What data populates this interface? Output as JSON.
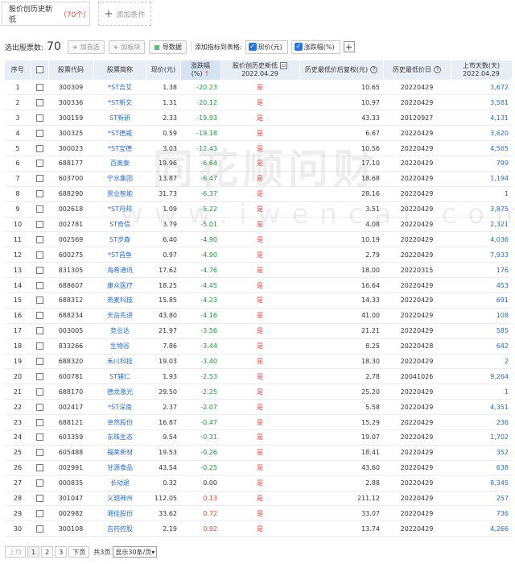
{
  "condition": {
    "label": "股价创历史新低",
    "count": "（70个）",
    "add_label": "添加条件"
  },
  "toolbar": {
    "selected_label": "选出股票数:",
    "selected_count": "70",
    "btn_add_watch": "加自选",
    "btn_add_block": "加板块",
    "btn_export": "导数据",
    "add_indicator_label": "添加指标到表格:",
    "indicators": [
      "现价(元)",
      "涨跌幅(%)"
    ]
  },
  "columns": [
    "序号",
    "股票代码",
    "股票简称",
    "现价(元)",
    "涨跌幅(%)",
    "股价创历史新低",
    "2022.04.29",
    "历史最低价后复权(元)",
    "历史最低价日",
    "上市天数(天)"
  ],
  "rows": [
    [
      "1",
      "300309",
      "*ST吉艾",
      "1.38",
      "-20.23",
      "是",
      "10.65",
      "20220429",
      "3,672"
    ],
    [
      "2",
      "300336",
      "*ST新文",
      "1.31",
      "-20.12",
      "是",
      "10.97",
      "20220429",
      "3,581"
    ],
    [
      "3",
      "300159",
      "ST新研",
      "2.33",
      "-19.93",
      "是",
      "43.33",
      "20120927",
      "4,131"
    ],
    [
      "4",
      "300325",
      "*ST德威",
      "0.59",
      "-19.18",
      "是",
      "6.67",
      "20220429",
      "3,620"
    ],
    [
      "5",
      "300023",
      "*ST宝德",
      "3.03",
      "-12.43",
      "是",
      "10.56",
      "20220429",
      "4,565"
    ],
    [
      "6",
      "688177",
      "百奥泰",
      "19.96",
      "-6.64",
      "是",
      "17.10",
      "20220429",
      "799"
    ],
    [
      "7",
      "603700",
      "宁水集团",
      "13.87",
      "-6.47",
      "是",
      "18.68",
      "20220429",
      "1,194"
    ],
    [
      "8",
      "688290",
      "景业智能",
      "31.73",
      "-6.37",
      "是",
      "28.16",
      "20220429",
      "1"
    ],
    [
      "9",
      "002618",
      "*ST丹邦",
      "1.09",
      "-5.22",
      "是",
      "3.51",
      "20220429",
      "3,875"
    ],
    [
      "10",
      "002781",
      "ST奇信",
      "3.79",
      "-5.01",
      "是",
      "4.08",
      "20220429",
      "2,321"
    ],
    [
      "11",
      "002569",
      "ST步森",
      "6.40",
      "-4.90",
      "是",
      "10.19",
      "20220429",
      "4,036"
    ],
    [
      "12",
      "600275",
      "*ST昌鱼",
      "0.97",
      "-4.90",
      "是",
      "2.79",
      "20220429",
      "7,933"
    ],
    [
      "13",
      "831305",
      "海希通讯",
      "17.62",
      "-4.76",
      "是",
      "18.00",
      "20220315",
      "176"
    ],
    [
      "14",
      "688607",
      "康众医疗",
      "18.25",
      "-4.45",
      "是",
      "16.64",
      "20220429",
      "453"
    ],
    [
      "15",
      "688312",
      "燕麦科技",
      "15.85",
      "-4.23",
      "是",
      "14.33",
      "20220429",
      "691"
    ],
    [
      "16",
      "688234",
      "天岳先进",
      "43.80",
      "-4.16",
      "是",
      "41.00",
      "20220429",
      "108"
    ],
    [
      "17",
      "003005",
      "竞业达",
      "21.97",
      "-3.56",
      "是",
      "21.21",
      "20220429",
      "585"
    ],
    [
      "18",
      "833266",
      "生物谷",
      "7.86",
      "-3.44",
      "是",
      "8.25",
      "20220428",
      "642"
    ],
    [
      "19",
      "688320",
      "禾川科技",
      "19.03",
      "-3.40",
      "是",
      "18.30",
      "20220429",
      "2"
    ],
    [
      "20",
      "600781",
      "ST辅仁",
      "1.93",
      "-2.53",
      "是",
      "2.78",
      "20041026",
      "9,264"
    ],
    [
      "21",
      "688170",
      "德龙激光",
      "29.50",
      "-2.25",
      "是",
      "25.20",
      "20220429",
      "1"
    ],
    [
      "22",
      "002417",
      "*ST深南",
      "2.37",
      "-2.07",
      "是",
      "5.58",
      "20220429",
      "4,351"
    ],
    [
      "23",
      "688121",
      "卓然股份",
      "16.87",
      "-0.47",
      "是",
      "15.29",
      "20220429",
      "236"
    ],
    [
      "24",
      "603359",
      "东珠生态",
      "9.54",
      "-0.31",
      "是",
      "19.07",
      "20220429",
      "1,702"
    ],
    [
      "25",
      "605488",
      "福莱新材",
      "19.53",
      "-0.26",
      "是",
      "18.41",
      "20220429",
      "352"
    ],
    [
      "26",
      "002991",
      "甘源食品",
      "43.54",
      "-0.25",
      "是",
      "43.60",
      "20220429",
      "638"
    ],
    [
      "27",
      "000835",
      "长动退",
      "0.32",
      "0.00",
      "是",
      "2.88",
      "20220429",
      "8,345"
    ],
    [
      "28",
      "301047",
      "义翘神州",
      "112.05",
      "0.13",
      "是",
      "211.12",
      "20220429",
      "257"
    ],
    [
      "29",
      "002982",
      "湘佳股份",
      "33.62",
      "0.72",
      "是",
      "33.07",
      "20220429",
      "736"
    ],
    [
      "30",
      "300108",
      "吉药控股",
      "2.19",
      "0.92",
      "是",
      "13.74",
      "20220429",
      "4,266"
    ]
  ],
  "pagination": {
    "prev": "上页",
    "pages": [
      "1",
      "2",
      "3"
    ],
    "next": "下页",
    "total": "共3页",
    "per_page": "显示30条/页"
  },
  "watermark": {
    "line1": "同花顺问财",
    "line2": "www.iwencai.com"
  },
  "colors": {
    "negative": "#1d9a3a",
    "positive": "#e8473a",
    "link": "#2a6ec6",
    "header_bg": "#e7eef6"
  }
}
